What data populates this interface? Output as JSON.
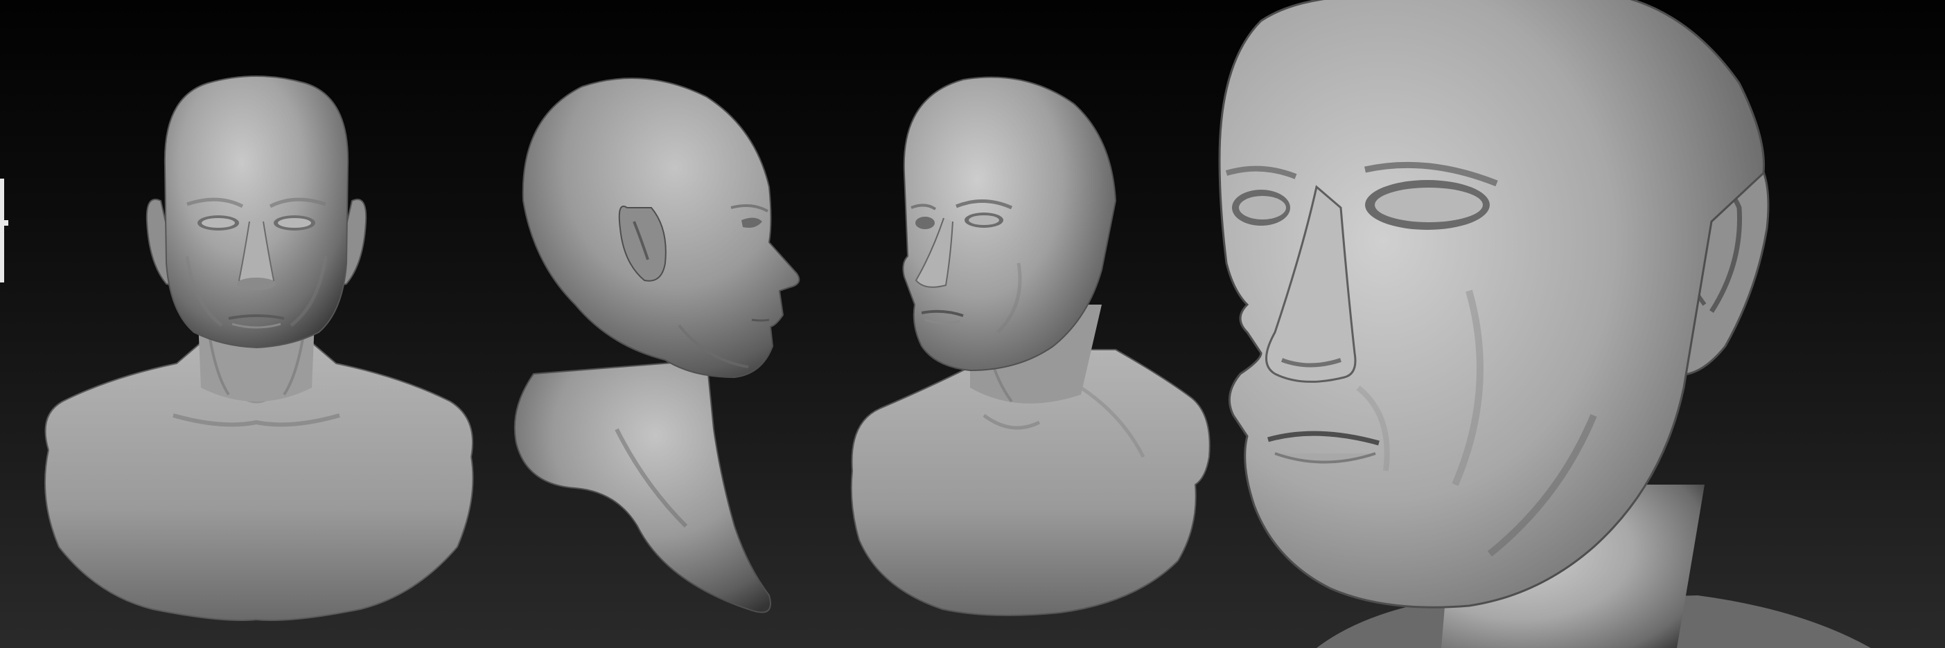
{
  "scene": {
    "background_top": "#020202",
    "background_bottom": "#2a2a2a",
    "material_color": "#9a9a9a",
    "views": [
      {
        "view": "front"
      },
      {
        "view": "side-profile"
      },
      {
        "view": "three-quarter"
      },
      {
        "view": "close-up"
      }
    ]
  }
}
